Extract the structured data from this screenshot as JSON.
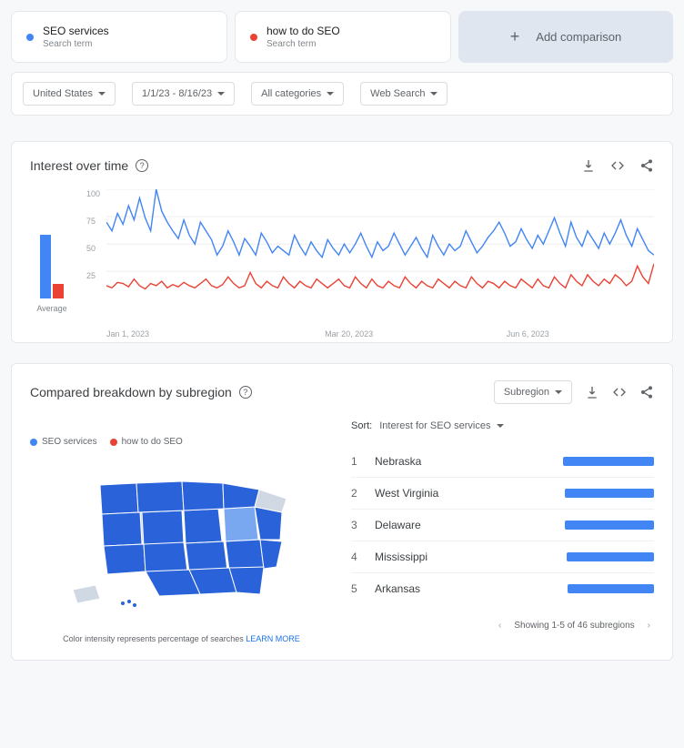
{
  "compare": {
    "terms": [
      {
        "label": "SEO services",
        "sublabel": "Search term",
        "color": "#4285F4"
      },
      {
        "label": "how to do SEO",
        "sublabel": "Search term",
        "color": "#EA4335"
      }
    ],
    "add_label": "Add comparison"
  },
  "filters": {
    "region": "United States",
    "timerange": "1/1/23 - 8/16/23",
    "category": "All categories",
    "search_type": "Web Search"
  },
  "interest_panel": {
    "title": "Interest over time",
    "y_ticks": [
      "100",
      "75",
      "50",
      "25"
    ],
    "x_ticks": [
      "Jan 1, 2023",
      "Mar 20, 2023",
      "Jun 6, 2023"
    ],
    "average_label": "Average",
    "average_values": {
      "blue": 58,
      "red": 13
    }
  },
  "chart_data": {
    "type": "line",
    "title": "Interest over time",
    "ylabel": "",
    "xlabel": "",
    "ylim": [
      0,
      100
    ],
    "x_range": "Jan 1, 2023 – Aug 16, 2023",
    "series": [
      {
        "name": "SEO services",
        "color": "#4285F4",
        "values": [
          70,
          62,
          78,
          68,
          85,
          72,
          92,
          74,
          62,
          100,
          80,
          70,
          62,
          55,
          72,
          58,
          50,
          70,
          62,
          54,
          40,
          48,
          62,
          52,
          40,
          55,
          48,
          40,
          60,
          52,
          42,
          48,
          44,
          40,
          58,
          48,
          40,
          52,
          44,
          38,
          54,
          46,
          40,
          50,
          42,
          50,
          60,
          48,
          38,
          52,
          44,
          48,
          60,
          50,
          40,
          48,
          56,
          46,
          38,
          58,
          48,
          40,
          50,
          44,
          48,
          62,
          52,
          42,
          48,
          56,
          62,
          70,
          60,
          48,
          52,
          64,
          54,
          46,
          58,
          50,
          62,
          74,
          60,
          48,
          70,
          56,
          48,
          62,
          54,
          46,
          60,
          50,
          60,
          72,
          58,
          48,
          64,
          54,
          44,
          40
        ]
      },
      {
        "name": "how to do SEO",
        "color": "#EA4335",
        "values": [
          12,
          10,
          15,
          14,
          11,
          18,
          12,
          9,
          14,
          12,
          16,
          10,
          13,
          11,
          15,
          12,
          10,
          14,
          18,
          12,
          10,
          13,
          20,
          14,
          10,
          12,
          24,
          14,
          10,
          16,
          12,
          10,
          20,
          14,
          10,
          16,
          12,
          10,
          18,
          14,
          10,
          14,
          18,
          12,
          10,
          20,
          14,
          10,
          18,
          12,
          10,
          16,
          12,
          10,
          20,
          14,
          10,
          16,
          12,
          10,
          18,
          14,
          10,
          16,
          12,
          10,
          20,
          14,
          10,
          16,
          14,
          10,
          16,
          12,
          10,
          18,
          14,
          10,
          18,
          12,
          10,
          20,
          14,
          10,
          22,
          16,
          12,
          22,
          16,
          12,
          18,
          14,
          22,
          18,
          12,
          16,
          30,
          20,
          14,
          32
        ]
      }
    ]
  },
  "subregion_panel": {
    "title": "Compared breakdown by subregion",
    "dropdown_label": "Subregion",
    "legend": [
      {
        "label": "SEO services",
        "color": "#4285F4"
      },
      {
        "label": "how to do SEO",
        "color": "#EA4335"
      }
    ],
    "sort_label": "Sort:",
    "sort_value": "Interest for SEO services",
    "regions": [
      {
        "rank": "1",
        "name": "Nebraska",
        "bar": 100
      },
      {
        "rank": "2",
        "name": "West Virginia",
        "bar": 98
      },
      {
        "rank": "3",
        "name": "Delaware",
        "bar": 98
      },
      {
        "rank": "4",
        "name": "Mississippi",
        "bar": 96
      },
      {
        "rank": "5",
        "name": "Arkansas",
        "bar": 95
      }
    ],
    "map_note": "Color intensity represents percentage of searches",
    "learn_more": "LEARN MORE",
    "pager_text": "Showing 1-5 of 46 subregions"
  }
}
